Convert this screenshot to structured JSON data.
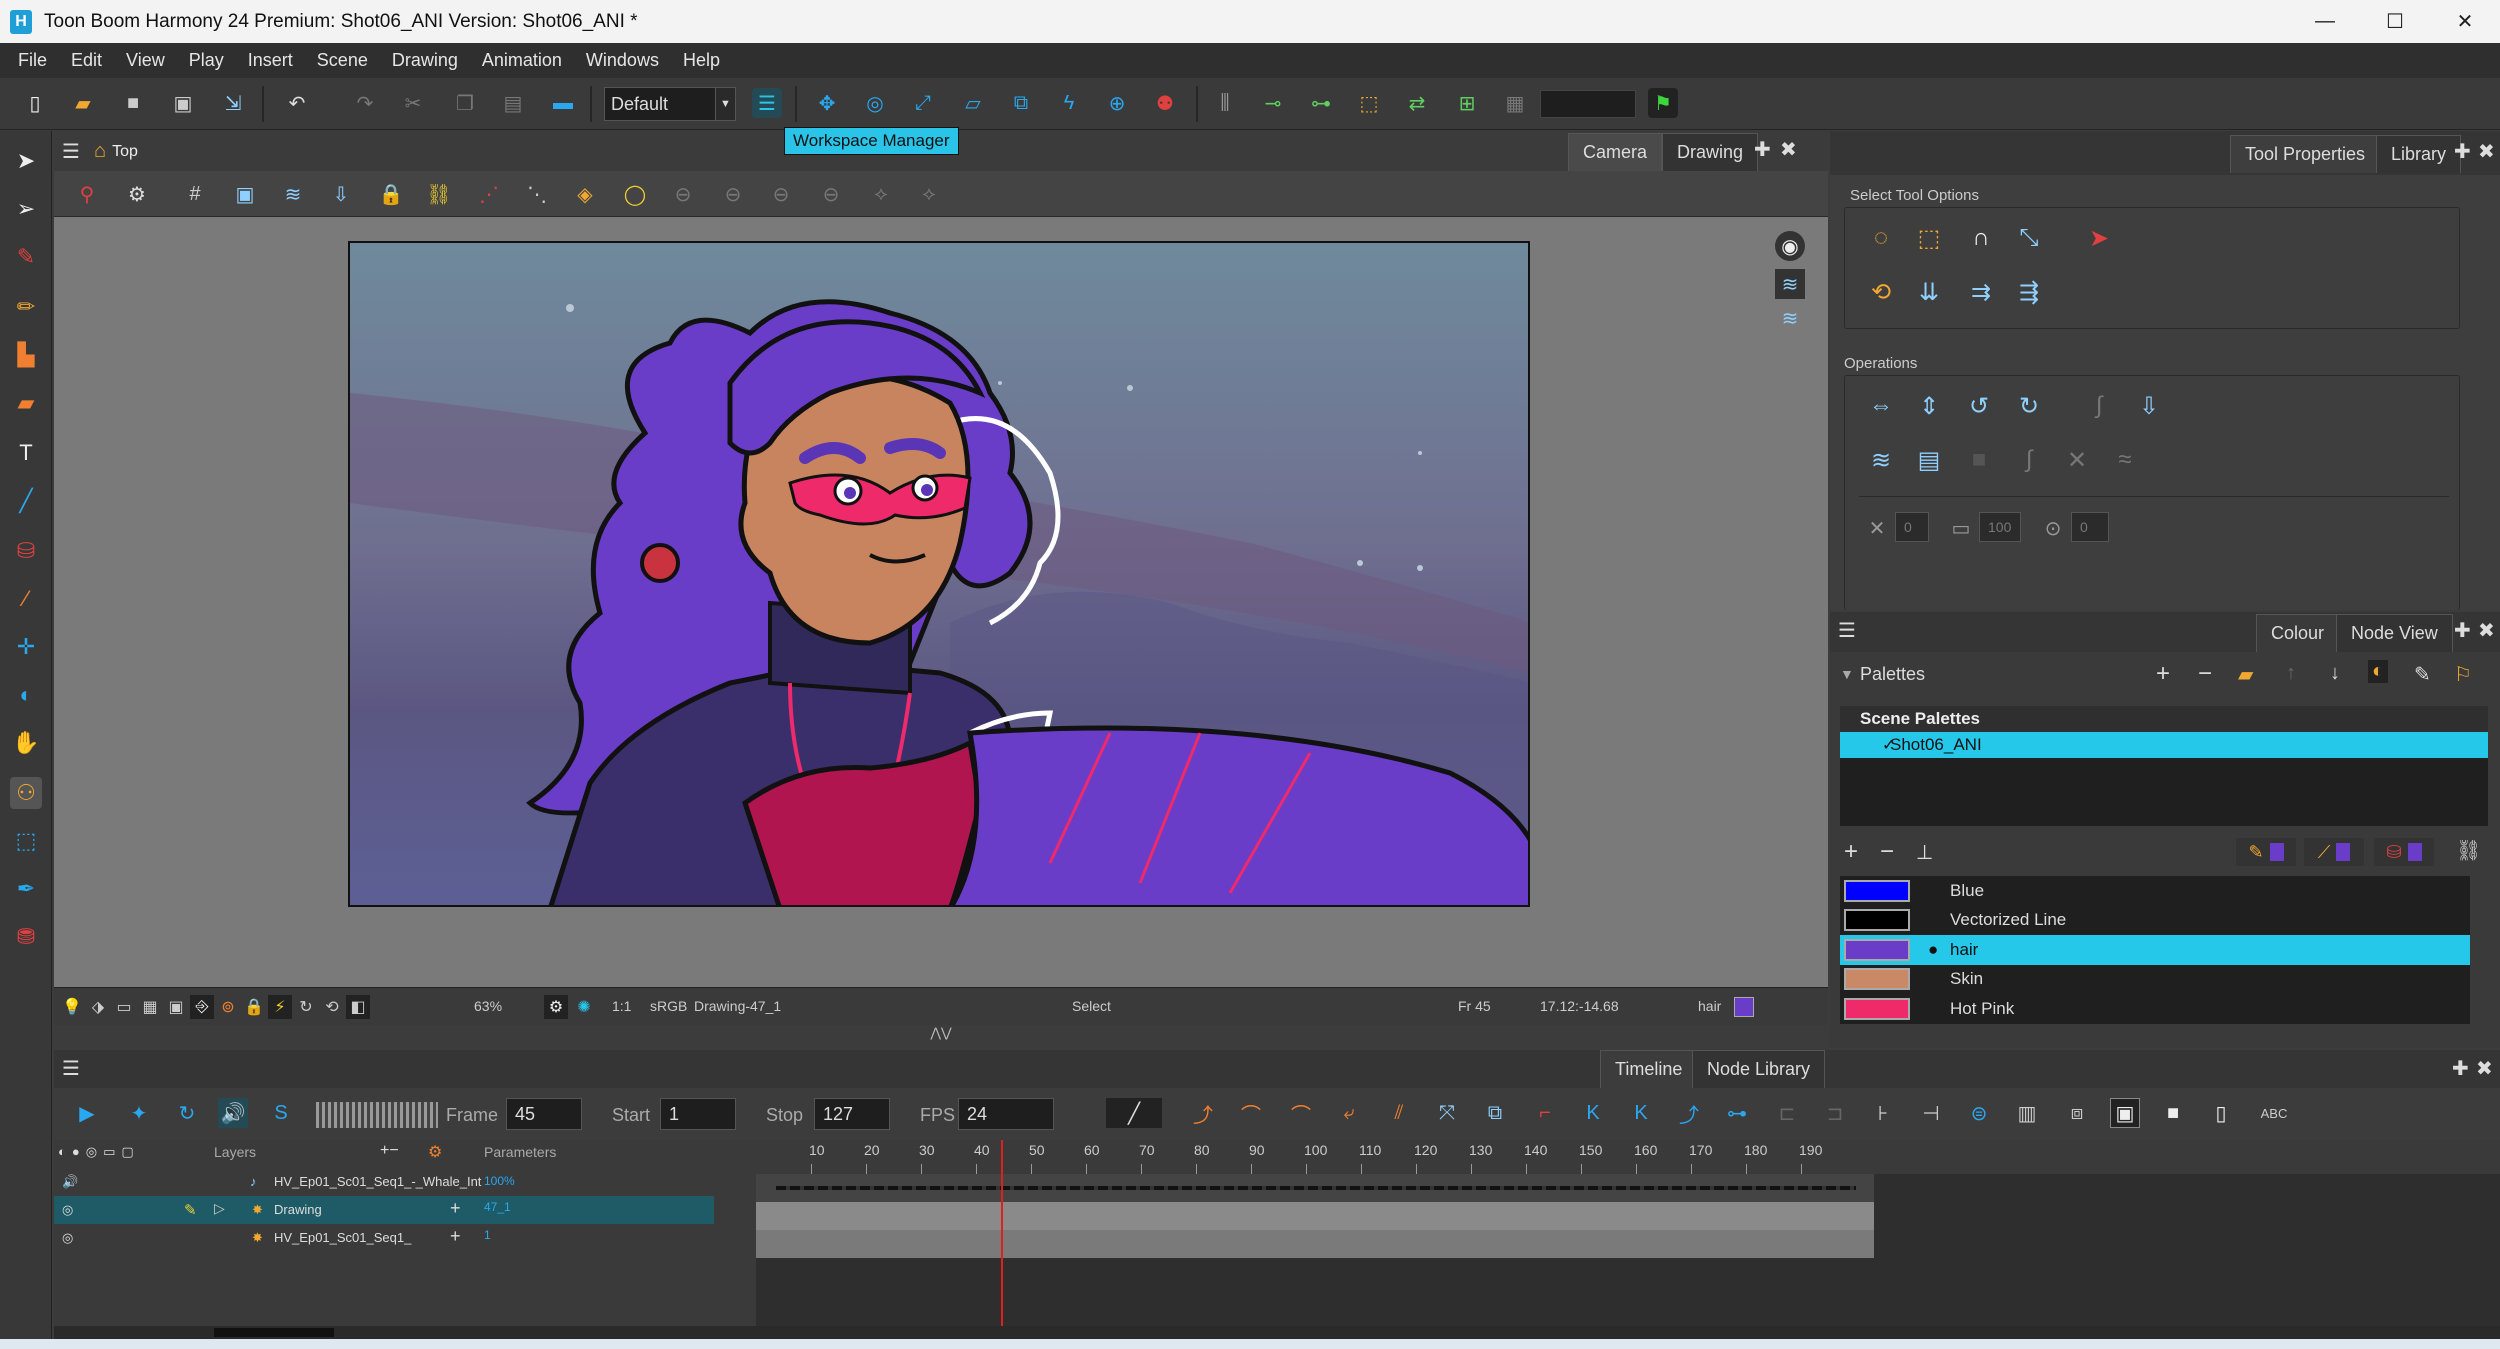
{
  "window": {
    "app_letter": "H",
    "title": "Toon Boom Harmony 24 Premium: Shot06_ANI Version: Shot06_ANI *",
    "minimize": "—",
    "maximize": "☐",
    "close": "✕"
  },
  "menu": [
    "File",
    "Edit",
    "View",
    "Play",
    "Insert",
    "Scene",
    "Drawing",
    "Animation",
    "Windows",
    "Help"
  ],
  "toolbar": {
    "workspace_value": "Default",
    "tooltip": "Workspace Manager"
  },
  "camera_view": {
    "breadcrumb": "Top",
    "tabs": [
      "Camera",
      "Drawing"
    ],
    "status": {
      "zoom": "63%",
      "ratio": "1:1",
      "colorspace": "sRGB",
      "drawing": "Drawing-47_1",
      "tool": "Select",
      "frame": "Fr 45",
      "coords": "17.12:-14.68",
      "colour_name": "hair"
    }
  },
  "tool_properties": {
    "tabs": [
      "Tool Properties",
      "Library"
    ],
    "select_tool_options": "Select Tool Options",
    "operations": "Operations",
    "fields": [
      "0",
      "100",
      "0"
    ]
  },
  "colour_panel": {
    "tabs": [
      "Colour",
      "Node View"
    ],
    "palettes_label": "Palettes",
    "scene_palettes_header": "Scene Palettes",
    "scene_palette_item": "Shot06_ANI",
    "swatches": [
      {
        "name": "Blue",
        "color": "#0000ff",
        "selected": false
      },
      {
        "name": "Vectorized Line",
        "color": "#000000",
        "selected": false
      },
      {
        "name": "hair",
        "color": "#6a3dc8",
        "selected": true
      },
      {
        "name": "Skin",
        "color": "#c98866",
        "selected": false
      },
      {
        "name": "Hot Pink",
        "color": "#ee2a6b",
        "selected": false
      }
    ]
  },
  "timeline": {
    "tabs": [
      "Timeline",
      "Node Library"
    ],
    "frame_label": "Frame",
    "frame_value": "45",
    "start_label": "Start",
    "start_value": "1",
    "stop_label": "Stop",
    "stop_value": "127",
    "fps_label": "FPS",
    "fps_value": "24",
    "layers_header": "Layers",
    "params_header": "Parameters",
    "layers": [
      {
        "name": "HV_Ep01_Sc01_Seq1_-_Whale_Int",
        "param": "100%"
      },
      {
        "name": "Drawing",
        "param": "47_1"
      },
      {
        "name": "HV_Ep01_Sc01_Seq1_",
        "param": "1"
      }
    ],
    "ruler": [
      "10",
      "20",
      "30",
      "40",
      "50",
      "60",
      "70",
      "80",
      "90",
      "100",
      "110",
      "120",
      "130",
      "140",
      "150",
      "160",
      "170",
      "180",
      "190"
    ],
    "current_frame": 45
  }
}
